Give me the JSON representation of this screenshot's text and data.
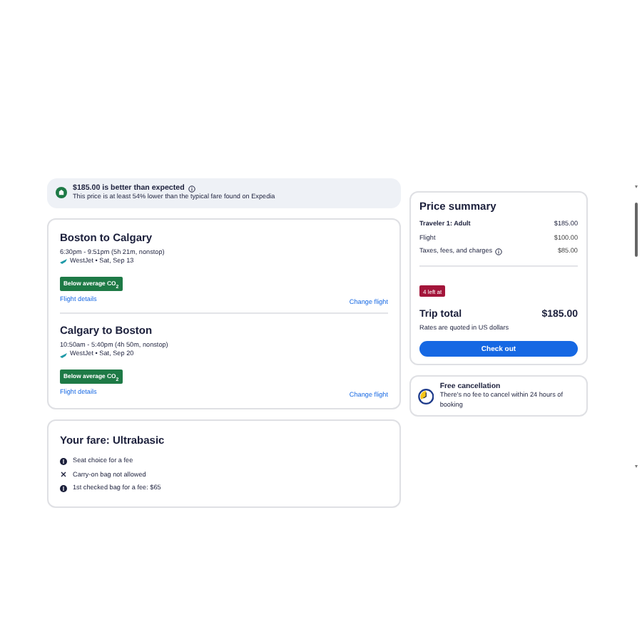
{
  "banner": {
    "title": "$185.00 is better than expected",
    "subtitle": "This price is at least 54% lower than the typical fare found on Expedia"
  },
  "flights": [
    {
      "route": "Boston to Calgary",
      "times": "6:30pm - 9:51pm (5h 21m, nonstop)",
      "airline_date": "WestJet • Sat, Sep 13",
      "badge": "Below average CO$_{2}$",
      "details_link": "Flight details",
      "change_link": "Change flight"
    },
    {
      "route": "Calgary to Boston",
      "times": "10:50am - 5:40pm (4h 50m, nonstop)",
      "airline_date": "WestJet • Sat, Sep 20",
      "badge": "Below average CO$_{2}$",
      "details_link": "Flight details",
      "change_link": "Change flight"
    }
  ],
  "fare": {
    "title": "Your fare: Ultrabasic",
    "features": [
      {
        "kind": "fee",
        "text": "Seat choice for a fee"
      },
      {
        "kind": "not_allowed",
        "text": "Carry-on bag not allowed"
      },
      {
        "kind": "fee",
        "text": "1st checked bag for a fee: $65"
      }
    ]
  },
  "price_summary": {
    "title": "Price summary",
    "lines": [
      {
        "label": "Traveler 1: Adult",
        "amount": "$185.00",
        "emphasis": true,
        "info": false
      },
      {
        "label": "Flight",
        "amount": "$100.00",
        "emphasis": false,
        "info": false
      },
      {
        "label": "Taxes, fees, and charges",
        "amount": "$85.00",
        "emphasis": false,
        "info": true
      }
    ],
    "scarcity_badge": "4 left at",
    "total_label": "Trip total",
    "total": "$185.00",
    "note": "Rates are quoted in US dollars",
    "button": "Check out"
  },
  "cancellation": {
    "title": "Free cancellation",
    "text": "There's no fee to cancel within 24 hours of booking"
  }
}
